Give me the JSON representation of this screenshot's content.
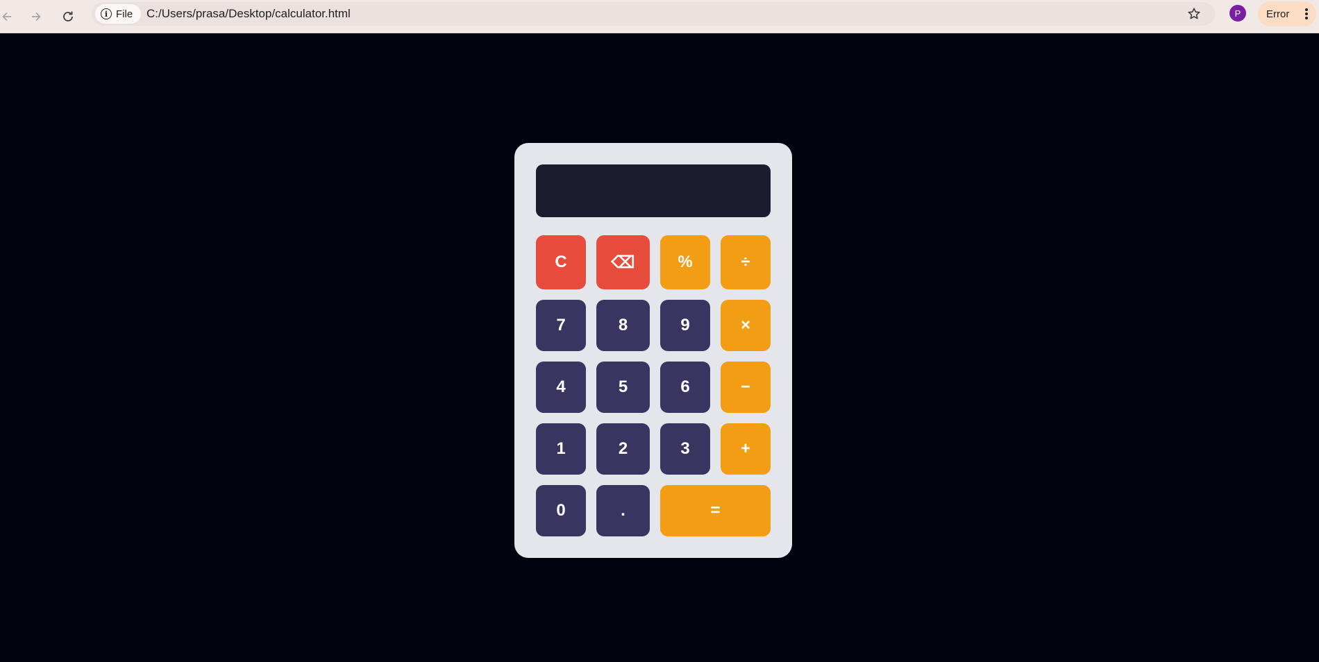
{
  "browser": {
    "chip_label": "File",
    "url": "C:/Users/prasa/Desktop/calculator.html",
    "profile_initial": "P",
    "status_label": "Error"
  },
  "calculator": {
    "display_value": "",
    "keys": {
      "clear": "C",
      "backspace": "⌫",
      "percent": "%",
      "divide": "÷",
      "seven": "7",
      "eight": "8",
      "nine": "9",
      "multiply": "×",
      "four": "4",
      "five": "5",
      "six": "6",
      "subtract": "−",
      "one": "1",
      "two": "2",
      "three": "3",
      "add": "+",
      "zero": "0",
      "decimal": ".",
      "equals": "="
    }
  },
  "colors": {
    "page_background": "#03020f",
    "calculator_body": "#e5e6ec",
    "display_background": "#1c1b2f",
    "number_key": "#393560",
    "operator_key": "#f29d14",
    "clear_key": "#e74c3c"
  }
}
